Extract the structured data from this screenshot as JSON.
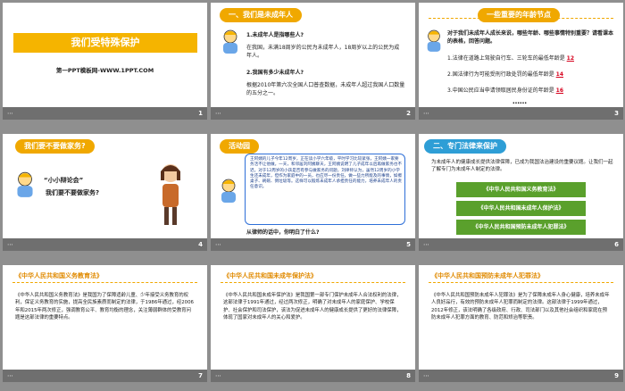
{
  "slides": [
    {
      "num": "1",
      "title": "我们受特殊保护",
      "subtitle": "第一PPT模板网-WWW.1PPT.COM"
    },
    {
      "num": "2",
      "tag": "一、我们是未成年人",
      "q1": "1.未成年人是指哪些人?",
      "a1": "在我国，未满18周岁的公民为未成年人，18周岁以上的公民为成年人。",
      "q2": "2.我国有多少未成年人?",
      "a2": "根据2010年第六次全国人口普查数据，未成年人超过我国人口数量的五分之一。"
    },
    {
      "num": "3",
      "tag": "一些重要的年龄节点",
      "intro": "对于我们未成年人成长来说，哪些年龄、哪些事情特别重要？请看课本的表格，回答问题。",
      "items": [
        {
          "text": "1.法律在道路上驾驶自行车、三轮车的最低年龄是",
          "value": "12"
        },
        {
          "text": "2.国法律行为可能受刑行政处罚的最低年龄是",
          "value": "14"
        },
        {
          "text": "3.中国公民应当申请领取居民身份证的年龄是",
          "value": "16"
        }
      ],
      "ellipsis": "……"
    },
    {
      "num": "4",
      "tag": "我们要不要做家务?",
      "q1": "“小小辩论会”",
      "q2": "我们要不要做家务?"
    },
    {
      "num": "5",
      "tag": "活动园",
      "story": "王阿姨的儿子今年12周岁，正在读小学六年级，平时学习比较紧张，王阿姨一家要务活不让他做。一天，和邻居刘阿姨聊天，王阿姨说明了儿子成年以后再做家务也不迟。对于12周岁的小孩是否有参与做家务的问题，刘律师认为，虽然12周岁的小学生还未成年，但作为家庭中的一员，也应尽一份责任，做一些力所能及的事情，如擦桌子、刷碗、倒垃圾等。这样可以锻炼未成年人承担责任的能力，培养未成年人的责任意识。",
      "question": "从律师的话中，你明白了什么?"
    },
    {
      "num": "6",
      "tag": "二、专门法律来保护",
      "intro": "为未成年人的健康成长提供法律保障，已成为我国法治建设的重要议题。让我们一起了解专门为未成年人制定的法律。",
      "laws": [
        "《中华人民共和国义务教育法》",
        "《中华人民共和国未成年人保护法》",
        "《中华人民共和国预防未成年人犯罪法》"
      ]
    },
    {
      "num": "7",
      "law": "《中华人民共和国义务教育法》",
      "body": "《中华人民共和国义务教育法》是我国为了保障适龄儿童、少年接受义务教育的权利，保证义务教育的实施，提高全民族素质而制定的法律，于1986年通过，经2006年和2015年两次修正，强调教育公平、教育均衡的理念，关注薄弱群体的受教育问题是这部法律的重要特点。"
    },
    {
      "num": "8",
      "law": "《中华人民共和国未成年保护法》",
      "body": "《中华人民共和国未成年保护法》是我国第一部专门保护未成年人合法权利的法律，这部法律于1991年通过，经过两次修正，明确了对未成年人的家庭保护、学校保护、社会保护和司法保护，该法为促进未成年人的健康成长提供了更好的法律保障，体现了国家对未成年人的关心和爱护。"
    },
    {
      "num": "9",
      "law": "《中华人民共和国预防未成年人犯罪法》",
      "body": "《中华人民共和国预防未成年人犯罪法》是为了保障未成年人身心健康，培养未成年人良好品行，有效的预防未成年人犯罪而制定的法律。这部法律于1999年通过，2012年修正，该法明确了各级政府、行政、司法部门以及其他社会组织和家庭在预防未成年人犯罪方面的教育、防范和矫治等职责。"
    }
  ],
  "footer_icon": "share-icon",
  "colors": {
    "yellow": "#f5b400",
    "teal": "#2e9ed6",
    "green": "#5aa02c",
    "red": "#d6001c",
    "footer": "#6f6f6f"
  }
}
